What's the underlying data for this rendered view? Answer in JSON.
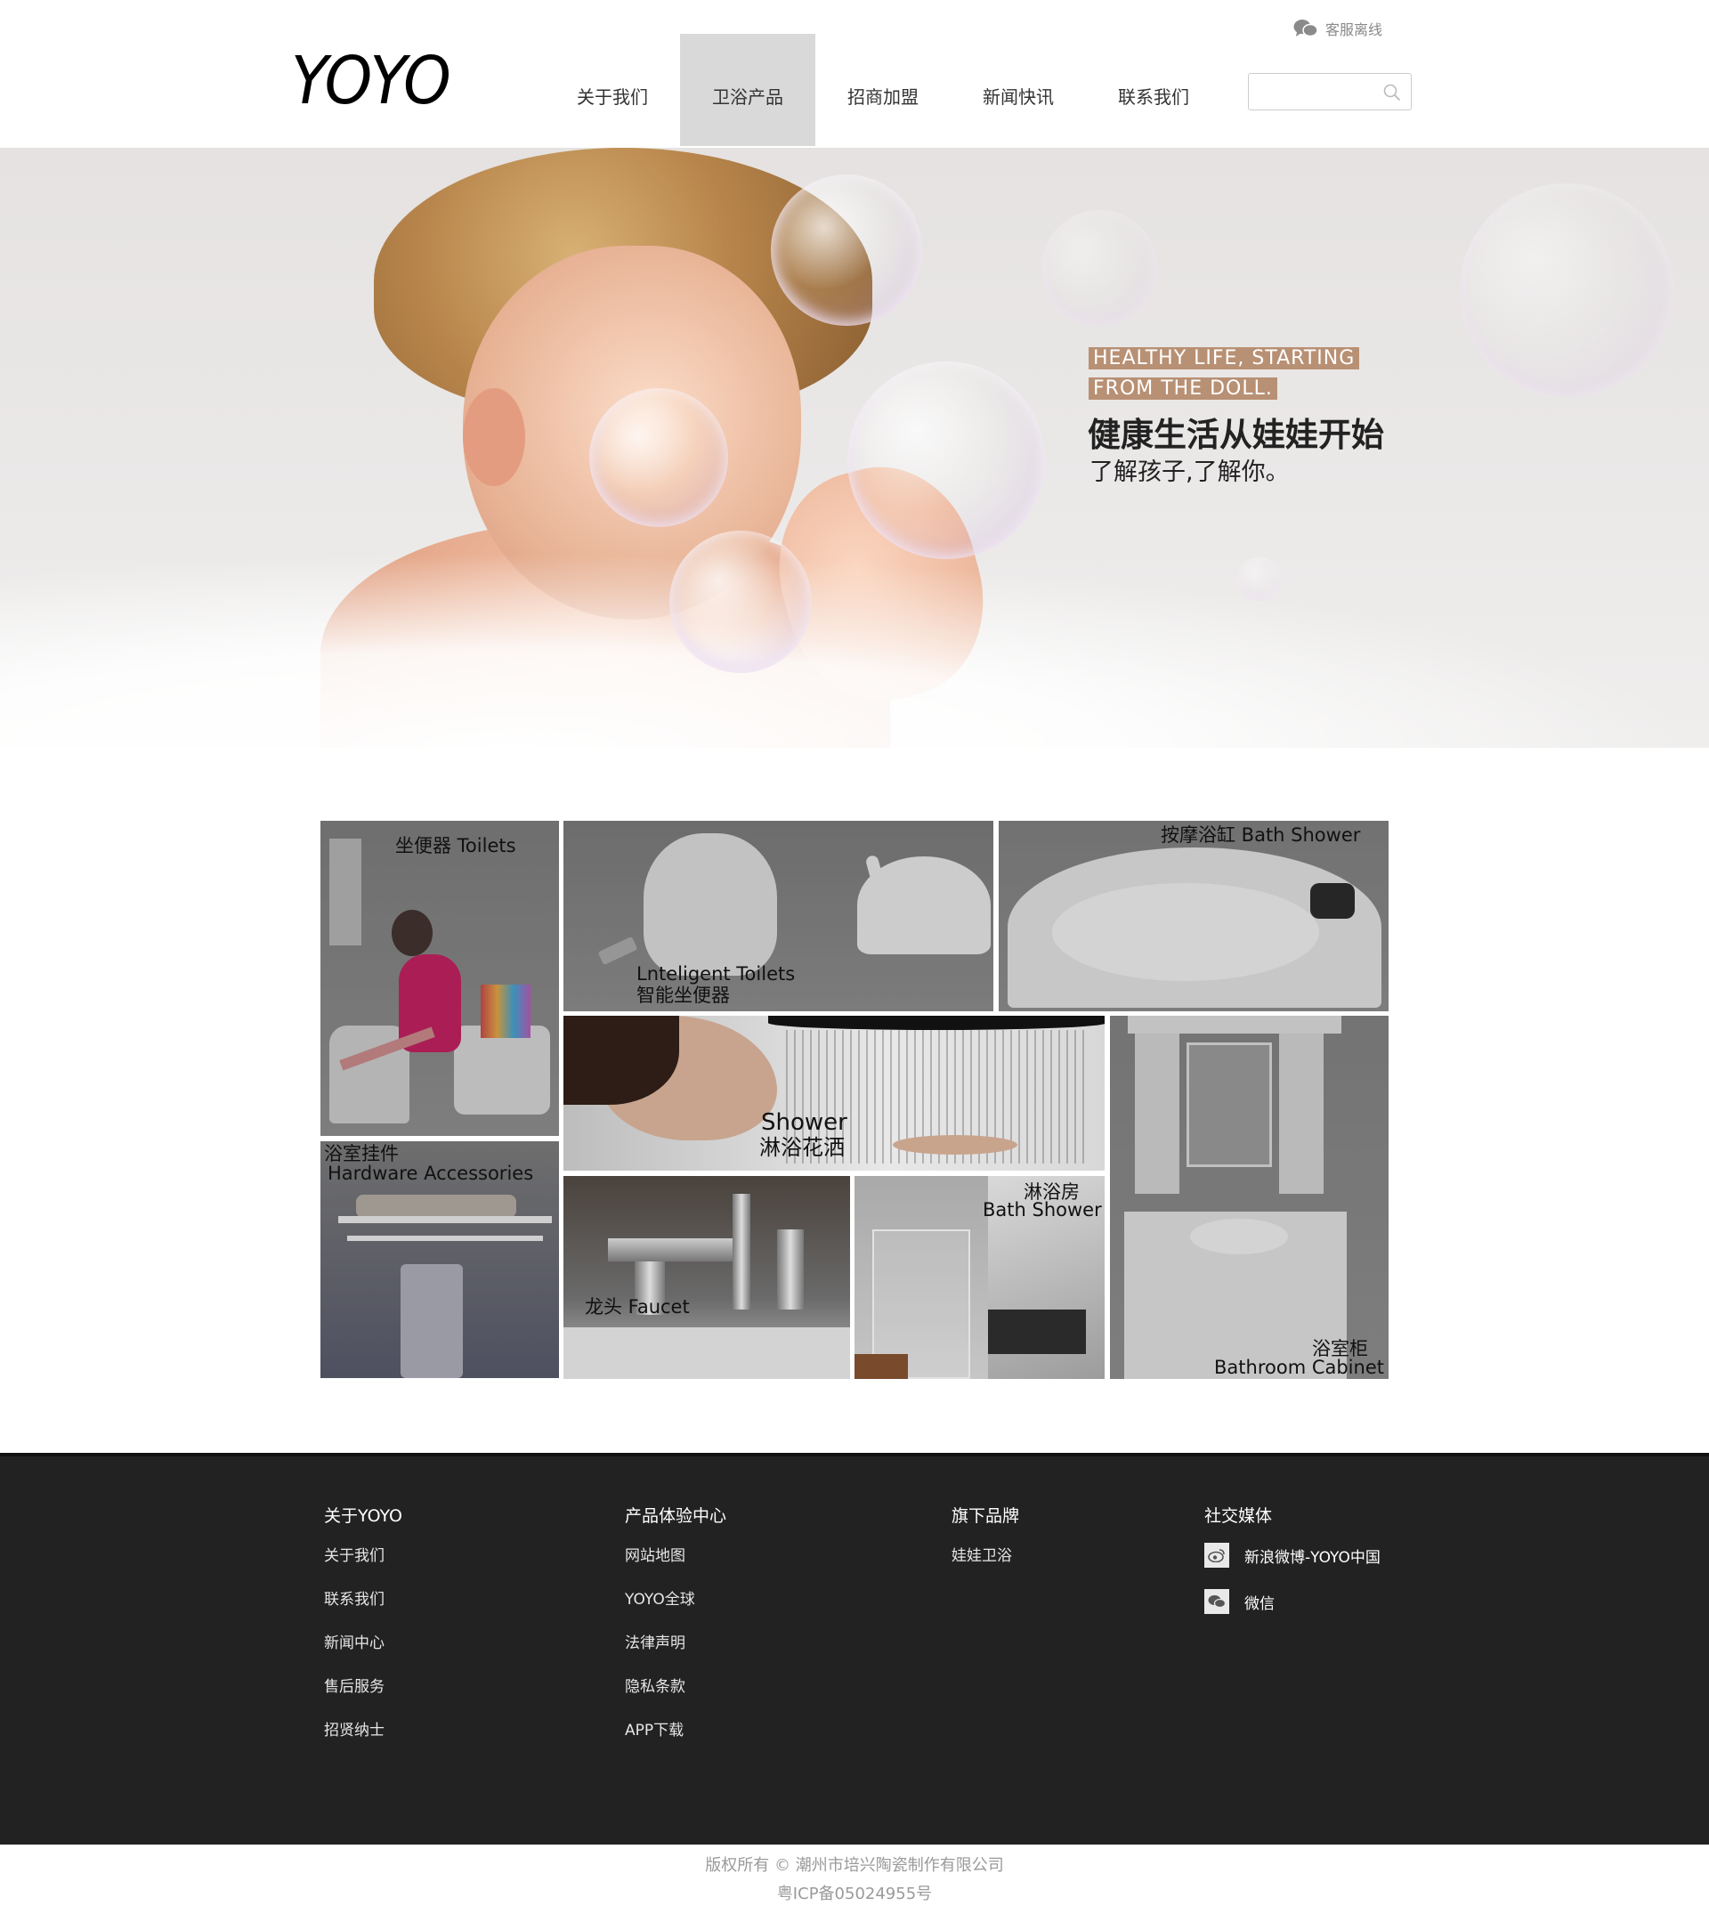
{
  "header": {
    "logo": "YOYO",
    "service_label": "客服离线",
    "search_placeholder": "",
    "nav": [
      {
        "label": "关于我们",
        "active": false
      },
      {
        "label": "卫浴产品",
        "active": true
      },
      {
        "label": "招商加盟",
        "active": false
      },
      {
        "label": "新闻快讯",
        "active": false
      },
      {
        "label": "联系我们",
        "active": false
      }
    ]
  },
  "hero": {
    "tag_line1": "HEALTHY LIFE, STARTING",
    "tag_line2": "FROM THE DOLL.",
    "title": "健康生活从娃娃开始",
    "subtitle": "了解孩子,了解你。"
  },
  "products": {
    "toilets": "坐便器 Toilets",
    "intelligent_en": "Lnteligent Toilets",
    "intelligent_cn": "智能坐便器",
    "bath_shower": "按摩浴缸 Bath Shower",
    "hardware_cn": "浴室挂件",
    "hardware_en": "Hardware Accessories",
    "shower_en": "Shower",
    "shower_cn": "淋浴花洒",
    "faucet": "龙头 Faucet",
    "shower_room_cn": "淋浴房",
    "shower_room_en": "Bath Shower",
    "cabinet_cn": "浴室柜",
    "cabinet_en": "Bathroom Cabinet"
  },
  "footer": {
    "col1": {
      "title": "关于YOYO",
      "links": [
        "关于我们",
        "联系我们",
        "新闻中心",
        "售后服务",
        "招贤纳士"
      ]
    },
    "col2": {
      "title": "产品体验中心",
      "links": [
        "网站地图",
        "YOYO全球",
        "法律声明",
        "隐私条款",
        "APP下载"
      ]
    },
    "col3": {
      "title": "旗下品牌",
      "links": [
        "娃娃卫浴"
      ]
    },
    "col4": {
      "title": "社交媒体",
      "social": [
        {
          "icon": "weibo-icon",
          "label": "新浪微博-YOYO中国"
        },
        {
          "icon": "wechat-icon",
          "label": "微信"
        }
      ]
    },
    "copyright": "版权所有 © 潮州市培兴陶瓷制作有限公司",
    "icp": "粤ICP备05024955号"
  }
}
